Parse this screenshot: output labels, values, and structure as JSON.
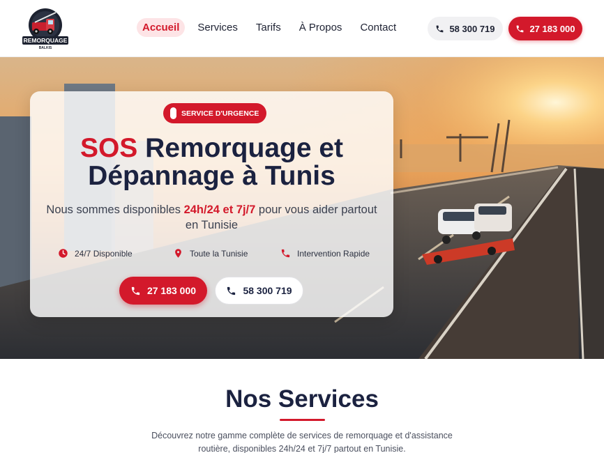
{
  "header": {
    "logo": {
      "line1": "REMORQUAGE",
      "line2": "BALKIS"
    },
    "nav": [
      {
        "label": "Accueil",
        "active": true
      },
      {
        "label": "Services",
        "active": false
      },
      {
        "label": "Tarifs",
        "active": false
      },
      {
        "label": "À Propos",
        "active": false
      },
      {
        "label": "Contact",
        "active": false
      }
    ],
    "phone_secondary": "58 300 719",
    "phone_primary": "27 183 000"
  },
  "hero": {
    "badge": "SERVICE D'URGENCE",
    "title_accent": "SOS",
    "title_line1_rest": " Remorquage et",
    "title_line2": "Dépannage à Tunis",
    "subtitle_pre": "Nous sommes disponibles ",
    "subtitle_bold": "24h/24 et 7j/7",
    "subtitle_post": " pour vous aider partout en Tunisie",
    "features": [
      {
        "icon": "clock-icon",
        "label": "24/7 Disponible"
      },
      {
        "icon": "map-pin-icon",
        "label": "Toute la Tunisie"
      },
      {
        "icon": "phone-icon",
        "label": "Intervention Rapide"
      }
    ],
    "cta_primary": "27 183 000",
    "cta_secondary": "58 300 719"
  },
  "services": {
    "title": "Nos Services",
    "description": "Découvrez notre gamme complète de services de remorquage et d'assistance routière, disponibles 24h/24 et 7j/7 partout en Tunisie."
  },
  "colors": {
    "accent": "#d3192b",
    "dark": "#1b2240"
  }
}
